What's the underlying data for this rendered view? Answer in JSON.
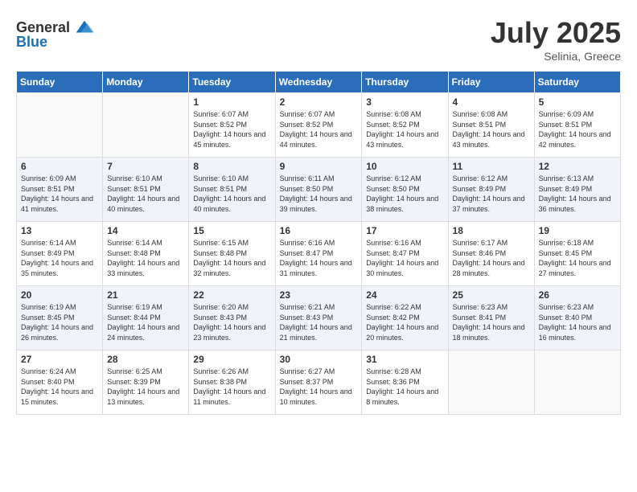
{
  "header": {
    "logo_general": "General",
    "logo_blue": "Blue",
    "title": "July 2025",
    "location": "Selinia, Greece"
  },
  "weekdays": [
    "Sunday",
    "Monday",
    "Tuesday",
    "Wednesday",
    "Thursday",
    "Friday",
    "Saturday"
  ],
  "weeks": [
    [
      {
        "day": "",
        "info": ""
      },
      {
        "day": "",
        "info": ""
      },
      {
        "day": "1",
        "info": "Sunrise: 6:07 AM\nSunset: 8:52 PM\nDaylight: 14 hours and 45 minutes."
      },
      {
        "day": "2",
        "info": "Sunrise: 6:07 AM\nSunset: 8:52 PM\nDaylight: 14 hours and 44 minutes."
      },
      {
        "day": "3",
        "info": "Sunrise: 6:08 AM\nSunset: 8:52 PM\nDaylight: 14 hours and 43 minutes."
      },
      {
        "day": "4",
        "info": "Sunrise: 6:08 AM\nSunset: 8:51 PM\nDaylight: 14 hours and 43 minutes."
      },
      {
        "day": "5",
        "info": "Sunrise: 6:09 AM\nSunset: 8:51 PM\nDaylight: 14 hours and 42 minutes."
      }
    ],
    [
      {
        "day": "6",
        "info": "Sunrise: 6:09 AM\nSunset: 8:51 PM\nDaylight: 14 hours and 41 minutes."
      },
      {
        "day": "7",
        "info": "Sunrise: 6:10 AM\nSunset: 8:51 PM\nDaylight: 14 hours and 40 minutes."
      },
      {
        "day": "8",
        "info": "Sunrise: 6:10 AM\nSunset: 8:51 PM\nDaylight: 14 hours and 40 minutes."
      },
      {
        "day": "9",
        "info": "Sunrise: 6:11 AM\nSunset: 8:50 PM\nDaylight: 14 hours and 39 minutes."
      },
      {
        "day": "10",
        "info": "Sunrise: 6:12 AM\nSunset: 8:50 PM\nDaylight: 14 hours and 38 minutes."
      },
      {
        "day": "11",
        "info": "Sunrise: 6:12 AM\nSunset: 8:49 PM\nDaylight: 14 hours and 37 minutes."
      },
      {
        "day": "12",
        "info": "Sunrise: 6:13 AM\nSunset: 8:49 PM\nDaylight: 14 hours and 36 minutes."
      }
    ],
    [
      {
        "day": "13",
        "info": "Sunrise: 6:14 AM\nSunset: 8:49 PM\nDaylight: 14 hours and 35 minutes."
      },
      {
        "day": "14",
        "info": "Sunrise: 6:14 AM\nSunset: 8:48 PM\nDaylight: 14 hours and 33 minutes."
      },
      {
        "day": "15",
        "info": "Sunrise: 6:15 AM\nSunset: 8:48 PM\nDaylight: 14 hours and 32 minutes."
      },
      {
        "day": "16",
        "info": "Sunrise: 6:16 AM\nSunset: 8:47 PM\nDaylight: 14 hours and 31 minutes."
      },
      {
        "day": "17",
        "info": "Sunrise: 6:16 AM\nSunset: 8:47 PM\nDaylight: 14 hours and 30 minutes."
      },
      {
        "day": "18",
        "info": "Sunrise: 6:17 AM\nSunset: 8:46 PM\nDaylight: 14 hours and 28 minutes."
      },
      {
        "day": "19",
        "info": "Sunrise: 6:18 AM\nSunset: 8:45 PM\nDaylight: 14 hours and 27 minutes."
      }
    ],
    [
      {
        "day": "20",
        "info": "Sunrise: 6:19 AM\nSunset: 8:45 PM\nDaylight: 14 hours and 26 minutes."
      },
      {
        "day": "21",
        "info": "Sunrise: 6:19 AM\nSunset: 8:44 PM\nDaylight: 14 hours and 24 minutes."
      },
      {
        "day": "22",
        "info": "Sunrise: 6:20 AM\nSunset: 8:43 PM\nDaylight: 14 hours and 23 minutes."
      },
      {
        "day": "23",
        "info": "Sunrise: 6:21 AM\nSunset: 8:43 PM\nDaylight: 14 hours and 21 minutes."
      },
      {
        "day": "24",
        "info": "Sunrise: 6:22 AM\nSunset: 8:42 PM\nDaylight: 14 hours and 20 minutes."
      },
      {
        "day": "25",
        "info": "Sunrise: 6:23 AM\nSunset: 8:41 PM\nDaylight: 14 hours and 18 minutes."
      },
      {
        "day": "26",
        "info": "Sunrise: 6:23 AM\nSunset: 8:40 PM\nDaylight: 14 hours and 16 minutes."
      }
    ],
    [
      {
        "day": "27",
        "info": "Sunrise: 6:24 AM\nSunset: 8:40 PM\nDaylight: 14 hours and 15 minutes."
      },
      {
        "day": "28",
        "info": "Sunrise: 6:25 AM\nSunset: 8:39 PM\nDaylight: 14 hours and 13 minutes."
      },
      {
        "day": "29",
        "info": "Sunrise: 6:26 AM\nSunset: 8:38 PM\nDaylight: 14 hours and 11 minutes."
      },
      {
        "day": "30",
        "info": "Sunrise: 6:27 AM\nSunset: 8:37 PM\nDaylight: 14 hours and 10 minutes."
      },
      {
        "day": "31",
        "info": "Sunrise: 6:28 AM\nSunset: 8:36 PM\nDaylight: 14 hours and 8 minutes."
      },
      {
        "day": "",
        "info": ""
      },
      {
        "day": "",
        "info": ""
      }
    ]
  ]
}
